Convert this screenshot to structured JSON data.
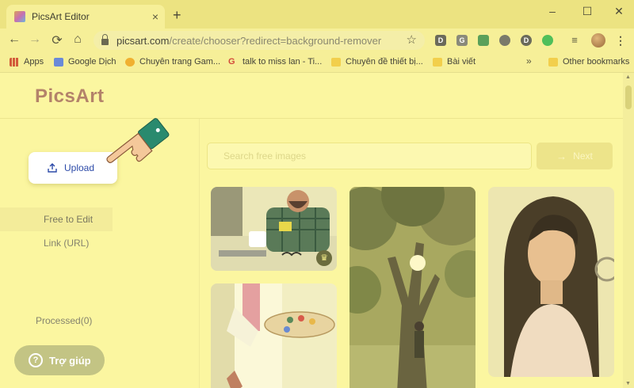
{
  "browser": {
    "tab_title": "PicsArt Editor",
    "tab_close": "×",
    "new_tab": "+",
    "window_controls": [
      "–",
      "☐",
      "✕"
    ],
    "nav": {
      "back": "←",
      "forward": "→",
      "reload": "⟳",
      "home": "⌂"
    },
    "url_host": "picsart.com",
    "url_path": "/create/chooser?redirect=background-remover",
    "bookmark_star": "☆",
    "extensions": [
      "D",
      "G",
      "",
      "",
      "D",
      ""
    ],
    "bookmarks": [
      {
        "label": "Apps",
        "icon": "apps-grid-icon"
      },
      {
        "label": "Google Dịch",
        "icon": "translate-icon"
      },
      {
        "label": "Chuyên trang Gam...",
        "icon": "game-icon"
      },
      {
        "label": "talk to miss lan - Ti...",
        "icon": "google-icon"
      },
      {
        "label": "Chuyên đề thiết bị...",
        "icon": "folder-icon"
      },
      {
        "label": "Bài viết",
        "icon": "folder-icon"
      }
    ],
    "bookmarks_more": "»",
    "other_bookmarks": "Other bookmarks"
  },
  "app": {
    "logo": "PicsArt",
    "upload_label": "Upload",
    "sidebar": {
      "free_to_edit": "Free to Edit",
      "link_url": "Link (URL)",
      "processed": "Processed(0)"
    },
    "help_label": "Trợ giúp",
    "help_icon_glyph": "?",
    "search_placeholder": "Search free images",
    "next_label": "Next",
    "next_arrow": "→",
    "crown_glyph": "♛",
    "photos": [
      {
        "subject": "man-at-desk",
        "premium": true
      },
      {
        "subject": "tree-in-forest",
        "premium": false
      },
      {
        "subject": "woman-portrait",
        "premium": false
      },
      {
        "subject": "painter-palette",
        "premium": false
      }
    ]
  },
  "colors": {
    "overlay_tint": "#fbf6a0",
    "upload_text": "#2c4aa8",
    "hand_cuff": "#2a8a6e",
    "hand_skin": "#f4c89a"
  }
}
